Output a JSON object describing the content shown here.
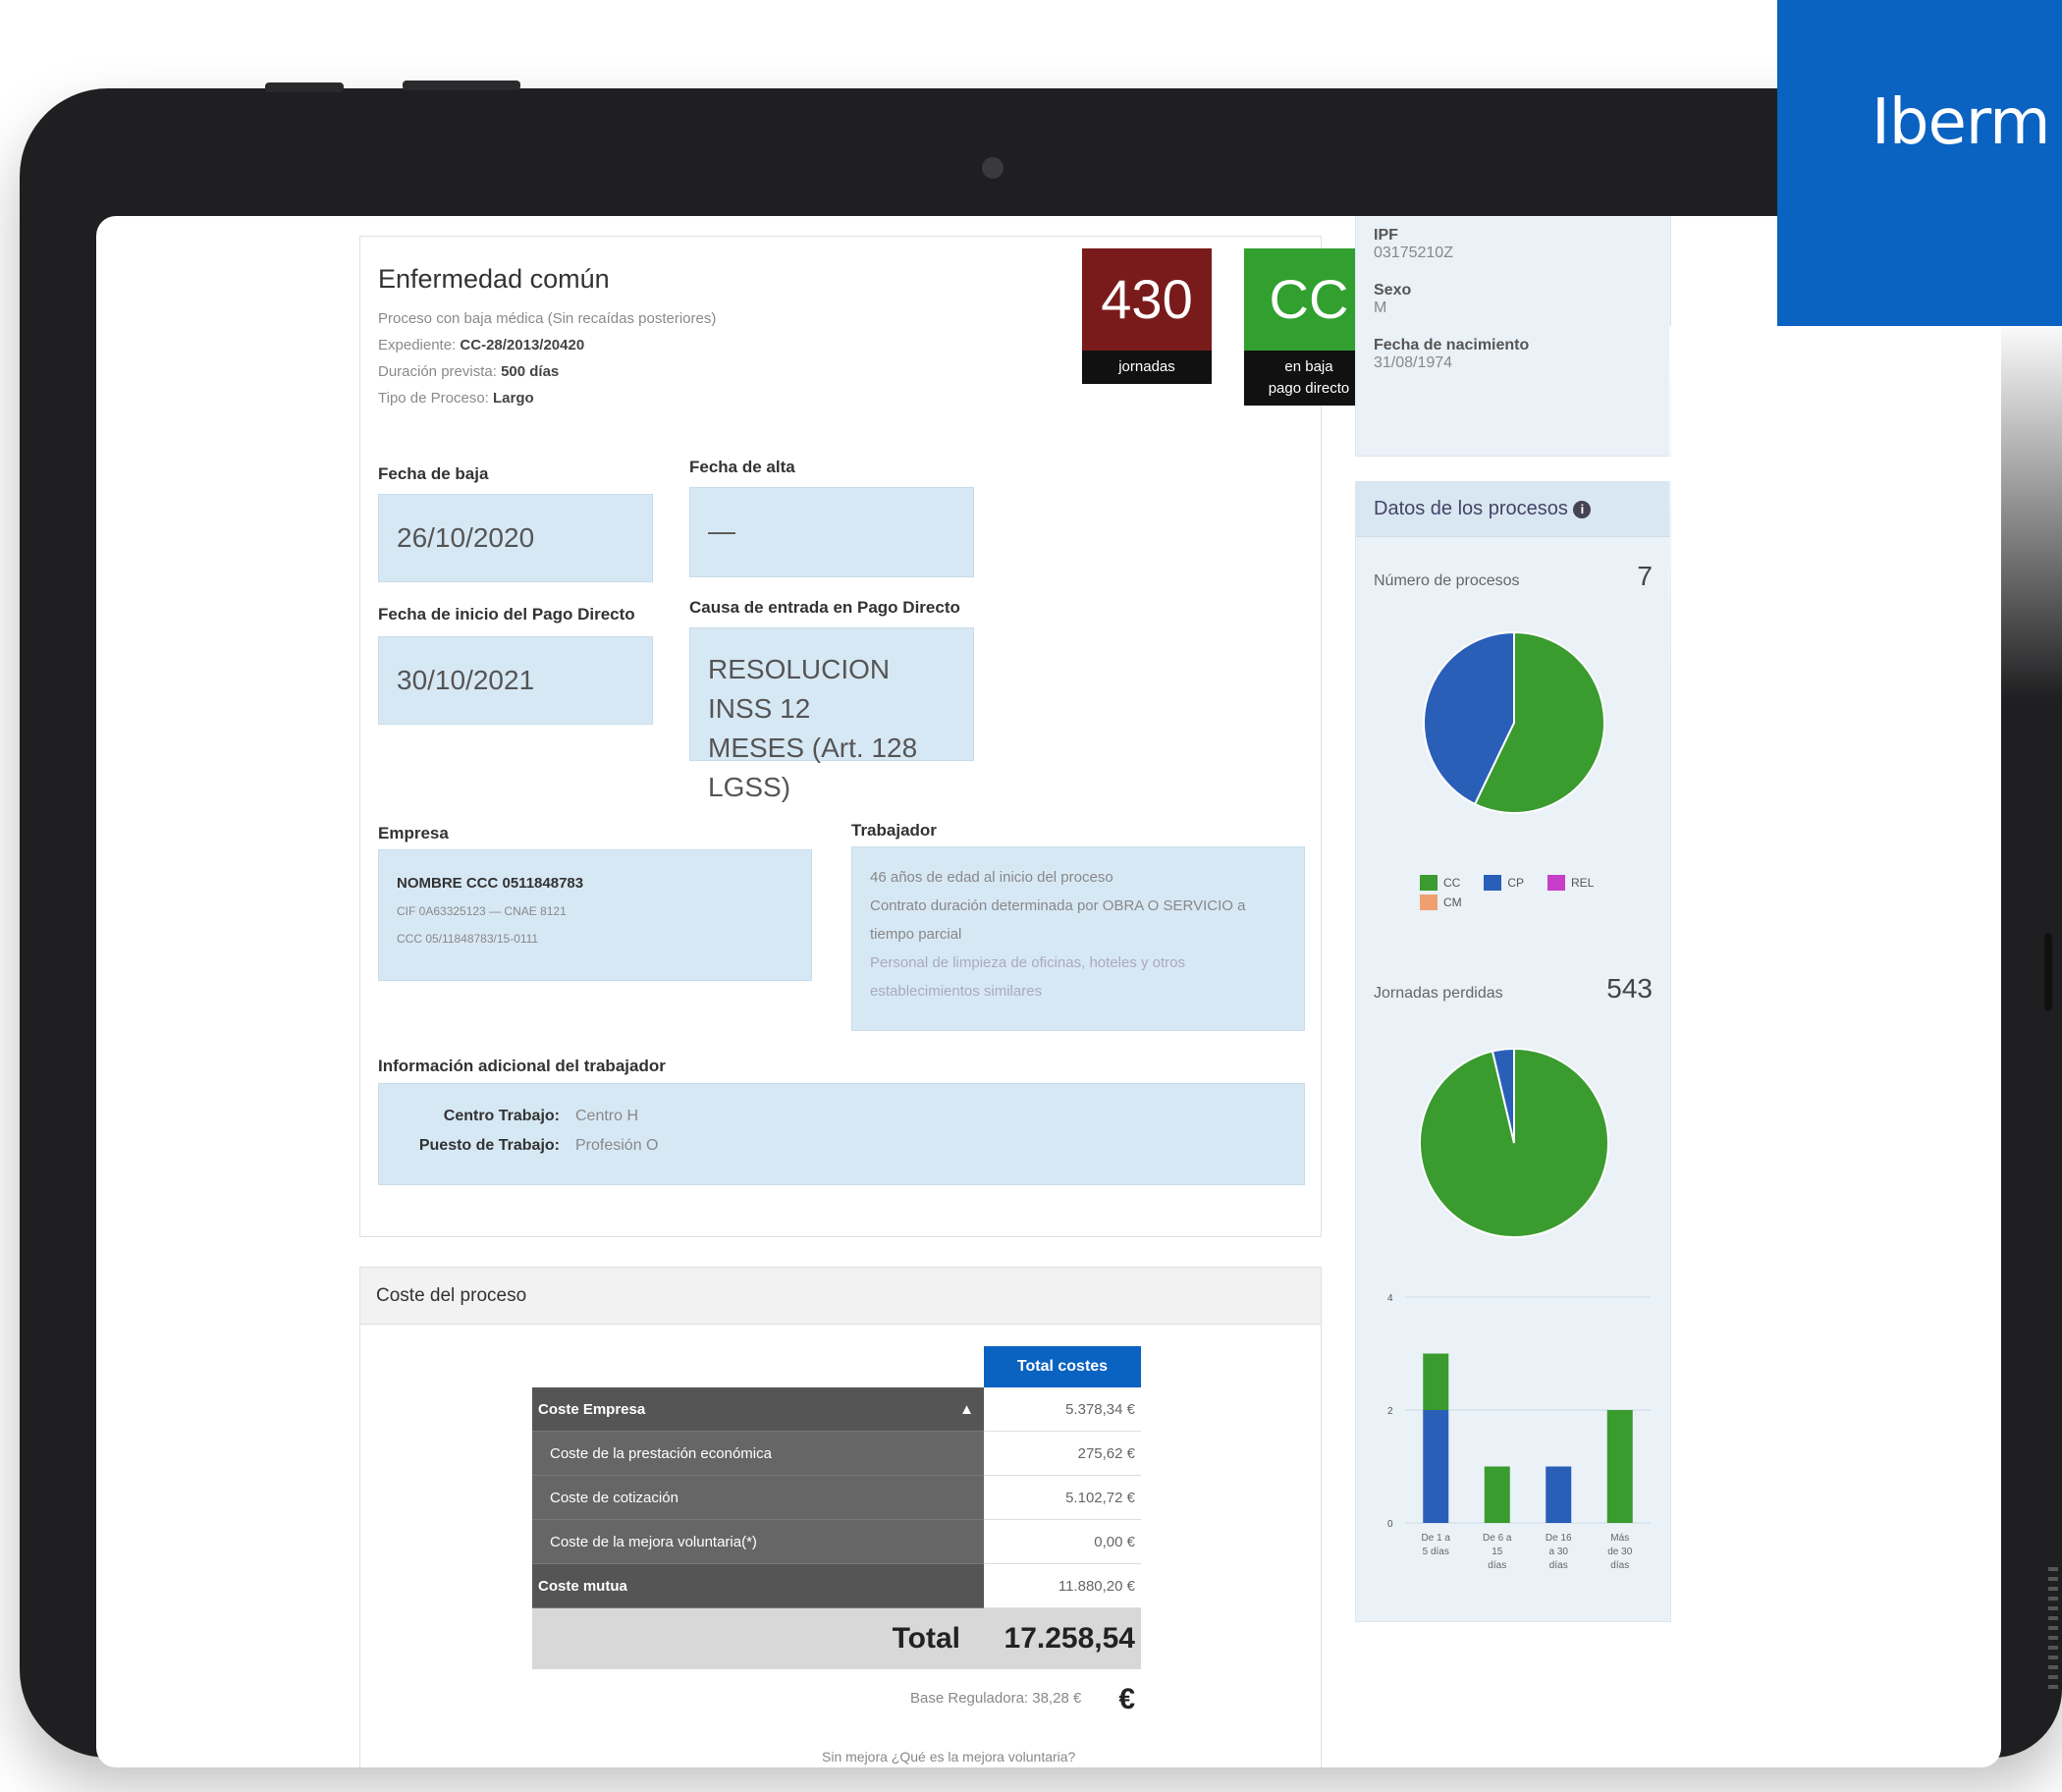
{
  "brand": {
    "name": "Iberm"
  },
  "process": {
    "title": "Enfermedad común",
    "subtitle": "Proceso con baja médica (Sin recaídas posteriores)",
    "expediente_label": "Expediente:",
    "expediente_value": "CC-28/2013/20420",
    "duracion_label": "Duración prevista:",
    "duracion_value": "500 días",
    "tipo_label": "Tipo de Proceso:",
    "tipo_value": "Largo"
  },
  "tiles": {
    "jornadas": {
      "value": "430",
      "label": "jornadas",
      "color": "#7a1b1b"
    },
    "estado": {
      "value": "CC",
      "label_line1": "en baja",
      "label_line2": "pago directo",
      "color": "#31a02f"
    }
  },
  "fields": {
    "fecha_baja": {
      "label": "Fecha de baja",
      "value": "26/10/2020"
    },
    "fecha_alta": {
      "label": "Fecha de alta",
      "value": "—"
    },
    "fecha_pago": {
      "label": "Fecha de inicio del Pago Directo",
      "value": "30/10/2021"
    },
    "causa": {
      "label": "Causa de entrada en Pago Directo",
      "value_line1": "RESOLUCION INSS 12",
      "value_line2": "MESES (Art. 128 LGSS)"
    }
  },
  "empresa": {
    "label": "Empresa",
    "nombre": "NOMBRE CCC 0511848783",
    "cif": "CIF 0A63325123 — CNAE 8121",
    "ccc": "CCC 05/11848783/15-0111"
  },
  "trabajador": {
    "label": "Trabajador",
    "line1": "46 años de edad al inicio del proceso",
    "line2": "Contrato duración determinada por OBRA O SERVICIO a",
    "line3": "tiempo parcial",
    "line4": "Personal de limpieza de oficinas, hoteles y otros",
    "line5": "establecimientos similares"
  },
  "adicional": {
    "label": "Información adicional del trabajador",
    "centro_key": "Centro Trabajo:",
    "centro_val": "Centro H",
    "puesto_key": "Puesto de Trabajo:",
    "puesto_val": "Profesión O"
  },
  "coste": {
    "header": "Coste del proceso",
    "col_header": "Total costes",
    "rows": [
      {
        "label": "Coste Empresa",
        "value": "5.378,34 €"
      },
      {
        "label": "Coste de la prestación económica",
        "value": "275,62 €"
      },
      {
        "label": "Coste de cotización",
        "value": "5.102,72 €"
      },
      {
        "label": "Coste de la mejora voluntaria(*)",
        "value": "0,00 €"
      },
      {
        "label": "Coste mutua",
        "value": "11.880,20 €"
      }
    ],
    "total_label": "Total",
    "total_value": "17.258,54 €",
    "base_reguladora": "Base Reguladora: 38,28 €",
    "mejora_note": "Sin mejora  ¿Qué es la mejora voluntaria?"
  },
  "persona": {
    "ipf_label": "IPF",
    "ipf_value": "03175210Z",
    "sexo_label": "Sexo",
    "sexo_value": "M",
    "nacimiento_label": "Fecha de nacimiento",
    "nacimiento_value": "31/08/1974"
  },
  "stats": {
    "header": "Datos de los procesos",
    "num_procesos_label": "Número de procesos",
    "num_procesos_value": "7",
    "jornadas_label": "Jornadas perdidas",
    "jornadas_value": "543",
    "legend": [
      {
        "name": "CC",
        "color": "#3a9b2f"
      },
      {
        "name": "CP",
        "color": "#2a5fb8"
      },
      {
        "name": "REL",
        "color": "#c83ec8"
      },
      {
        "name": "CM",
        "color": "#f0a070"
      }
    ]
  },
  "chart_data": [
    {
      "type": "pie",
      "categories": [
        "CC",
        "CP",
        "REL",
        "CM"
      ],
      "values": [
        4,
        3,
        0,
        0
      ],
      "colors": [
        "#3a9b2f",
        "#2a5fb8",
        "#c83ec8",
        "#f0a070"
      ]
    },
    {
      "type": "pie",
      "categories": [
        "CC",
        "CP",
        "REL",
        "CM"
      ],
      "values": [
        523,
        20,
        0,
        0
      ],
      "colors": [
        "#3a9b2f",
        "#2a5fb8",
        "#c83ec8",
        "#f0a070"
      ]
    },
    {
      "type": "bar",
      "stacked": true,
      "categories": [
        "De 1 a 5 días",
        "De 6 a 15 días",
        "De 16 a 30 días",
        "Más de 30 días"
      ],
      "tick_labels": [
        [
          "De 1 a",
          "5 días"
        ],
        [
          "De 6 a",
          "15",
          "días"
        ],
        [
          "De 16",
          "a 30",
          "días"
        ],
        [
          "Más",
          "de 30",
          "días"
        ]
      ],
      "series": [
        {
          "name": "CP",
          "values": [
            2,
            0,
            1,
            0
          ],
          "color": "#2a5fb8"
        },
        {
          "name": "CC",
          "values": [
            1,
            1,
            0,
            2
          ],
          "color": "#3a9b2f"
        }
      ],
      "y_ticks": [
        "0",
        "2",
        "4"
      ],
      "ylim": [
        0,
        4
      ],
      "grid": true
    }
  ]
}
